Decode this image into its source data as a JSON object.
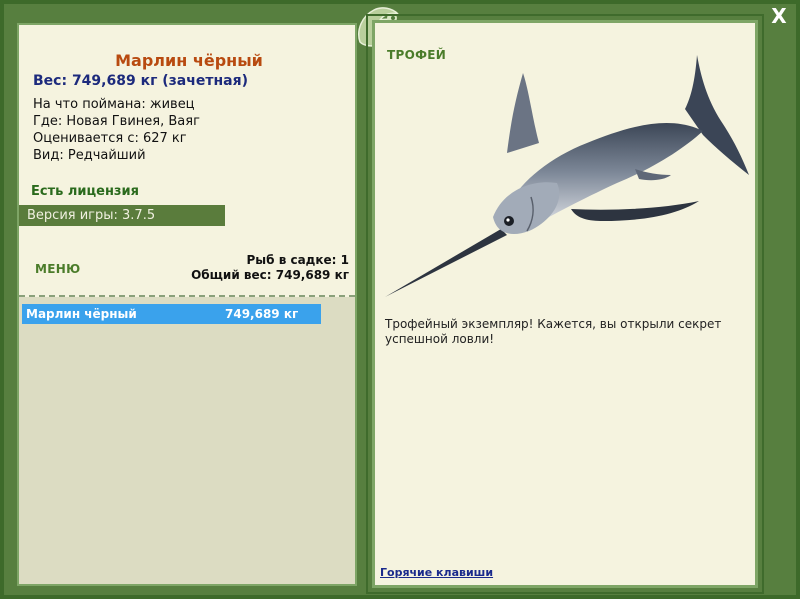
{
  "window": {
    "close_label": "X"
  },
  "fish": {
    "title": "Марлин чёрный",
    "weight_line": "Вес: 749,689 кг (зачетная)",
    "caught_on": "На что поймана: живец",
    "where": "Где: Новая Гвинея, Ваяг",
    "rated_from": "Оценивается с: 627 кг",
    "kind": "Вид: Редчайший"
  },
  "license": "Есть лицензия",
  "version": "Версия игры: 3.7.5",
  "menu_label": "МЕНЮ",
  "keepnet": {
    "count_line": "Рыб в садке: 1",
    "total_line": "Общий вес: 749,689 кг"
  },
  "catch_list": [
    {
      "name": "Марлин чёрный",
      "weight": "749,689 кг"
    }
  ],
  "trophy": {
    "label": "ТРОФЕЙ",
    "description": "Трофейный экземпляр! Кажется, вы открыли секрет успешной ловли!"
  },
  "hotkeys_link": "Горячие клавиши",
  "colors": {
    "frame_green": "#577f3f",
    "panel_bg": "#f5f3df",
    "selected_row": "#3aa2ec",
    "fish_title": "#b84a10",
    "weight_text": "#1c2a7c"
  },
  "icons": [
    "close-icon",
    "game-logo-icon",
    "marlin-image"
  ]
}
